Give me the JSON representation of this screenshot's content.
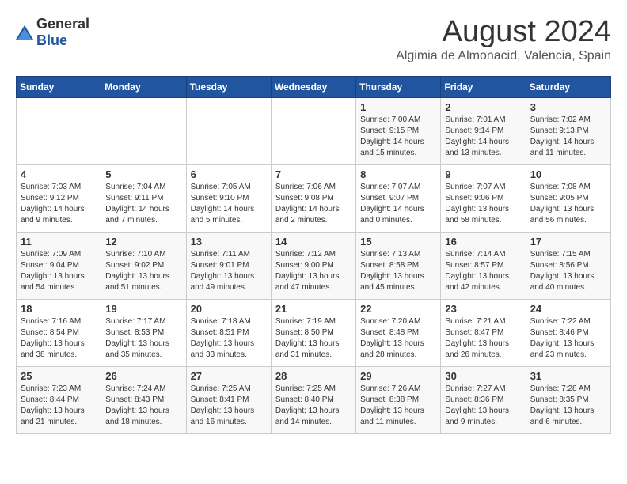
{
  "logo": {
    "general": "General",
    "blue": "Blue"
  },
  "header": {
    "month_year": "August 2024",
    "location": "Algimia de Almonacid, Valencia, Spain"
  },
  "days_of_week": [
    "Sunday",
    "Monday",
    "Tuesday",
    "Wednesday",
    "Thursday",
    "Friday",
    "Saturday"
  ],
  "weeks": [
    {
      "days": [
        {
          "num": "",
          "content": ""
        },
        {
          "num": "",
          "content": ""
        },
        {
          "num": "",
          "content": ""
        },
        {
          "num": "",
          "content": ""
        },
        {
          "num": "1",
          "content": "Sunrise: 7:00 AM\nSunset: 9:15 PM\nDaylight: 14 hours\nand 15 minutes."
        },
        {
          "num": "2",
          "content": "Sunrise: 7:01 AM\nSunset: 9:14 PM\nDaylight: 14 hours\nand 13 minutes."
        },
        {
          "num": "3",
          "content": "Sunrise: 7:02 AM\nSunset: 9:13 PM\nDaylight: 14 hours\nand 11 minutes."
        }
      ]
    },
    {
      "days": [
        {
          "num": "4",
          "content": "Sunrise: 7:03 AM\nSunset: 9:12 PM\nDaylight: 14 hours\nand 9 minutes."
        },
        {
          "num": "5",
          "content": "Sunrise: 7:04 AM\nSunset: 9:11 PM\nDaylight: 14 hours\nand 7 minutes."
        },
        {
          "num": "6",
          "content": "Sunrise: 7:05 AM\nSunset: 9:10 PM\nDaylight: 14 hours\nand 5 minutes."
        },
        {
          "num": "7",
          "content": "Sunrise: 7:06 AM\nSunset: 9:08 PM\nDaylight: 14 hours\nand 2 minutes."
        },
        {
          "num": "8",
          "content": "Sunrise: 7:07 AM\nSunset: 9:07 PM\nDaylight: 14 hours\nand 0 minutes."
        },
        {
          "num": "9",
          "content": "Sunrise: 7:07 AM\nSunset: 9:06 PM\nDaylight: 13 hours\nand 58 minutes."
        },
        {
          "num": "10",
          "content": "Sunrise: 7:08 AM\nSunset: 9:05 PM\nDaylight: 13 hours\nand 56 minutes."
        }
      ]
    },
    {
      "days": [
        {
          "num": "11",
          "content": "Sunrise: 7:09 AM\nSunset: 9:04 PM\nDaylight: 13 hours\nand 54 minutes."
        },
        {
          "num": "12",
          "content": "Sunrise: 7:10 AM\nSunset: 9:02 PM\nDaylight: 13 hours\nand 51 minutes."
        },
        {
          "num": "13",
          "content": "Sunrise: 7:11 AM\nSunset: 9:01 PM\nDaylight: 13 hours\nand 49 minutes."
        },
        {
          "num": "14",
          "content": "Sunrise: 7:12 AM\nSunset: 9:00 PM\nDaylight: 13 hours\nand 47 minutes."
        },
        {
          "num": "15",
          "content": "Sunrise: 7:13 AM\nSunset: 8:58 PM\nDaylight: 13 hours\nand 45 minutes."
        },
        {
          "num": "16",
          "content": "Sunrise: 7:14 AM\nSunset: 8:57 PM\nDaylight: 13 hours\nand 42 minutes."
        },
        {
          "num": "17",
          "content": "Sunrise: 7:15 AM\nSunset: 8:56 PM\nDaylight: 13 hours\nand 40 minutes."
        }
      ]
    },
    {
      "days": [
        {
          "num": "18",
          "content": "Sunrise: 7:16 AM\nSunset: 8:54 PM\nDaylight: 13 hours\nand 38 minutes."
        },
        {
          "num": "19",
          "content": "Sunrise: 7:17 AM\nSunset: 8:53 PM\nDaylight: 13 hours\nand 35 minutes."
        },
        {
          "num": "20",
          "content": "Sunrise: 7:18 AM\nSunset: 8:51 PM\nDaylight: 13 hours\nand 33 minutes."
        },
        {
          "num": "21",
          "content": "Sunrise: 7:19 AM\nSunset: 8:50 PM\nDaylight: 13 hours\nand 31 minutes."
        },
        {
          "num": "22",
          "content": "Sunrise: 7:20 AM\nSunset: 8:48 PM\nDaylight: 13 hours\nand 28 minutes."
        },
        {
          "num": "23",
          "content": "Sunrise: 7:21 AM\nSunset: 8:47 PM\nDaylight: 13 hours\nand 26 minutes."
        },
        {
          "num": "24",
          "content": "Sunrise: 7:22 AM\nSunset: 8:46 PM\nDaylight: 13 hours\nand 23 minutes."
        }
      ]
    },
    {
      "days": [
        {
          "num": "25",
          "content": "Sunrise: 7:23 AM\nSunset: 8:44 PM\nDaylight: 13 hours\nand 21 minutes."
        },
        {
          "num": "26",
          "content": "Sunrise: 7:24 AM\nSunset: 8:43 PM\nDaylight: 13 hours\nand 18 minutes."
        },
        {
          "num": "27",
          "content": "Sunrise: 7:25 AM\nSunset: 8:41 PM\nDaylight: 13 hours\nand 16 minutes."
        },
        {
          "num": "28",
          "content": "Sunrise: 7:25 AM\nSunset: 8:40 PM\nDaylight: 13 hours\nand 14 minutes."
        },
        {
          "num": "29",
          "content": "Sunrise: 7:26 AM\nSunset: 8:38 PM\nDaylight: 13 hours\nand 11 minutes."
        },
        {
          "num": "30",
          "content": "Sunrise: 7:27 AM\nSunset: 8:36 PM\nDaylight: 13 hours\nand 9 minutes."
        },
        {
          "num": "31",
          "content": "Sunrise: 7:28 AM\nSunset: 8:35 PM\nDaylight: 13 hours\nand 6 minutes."
        }
      ]
    }
  ]
}
